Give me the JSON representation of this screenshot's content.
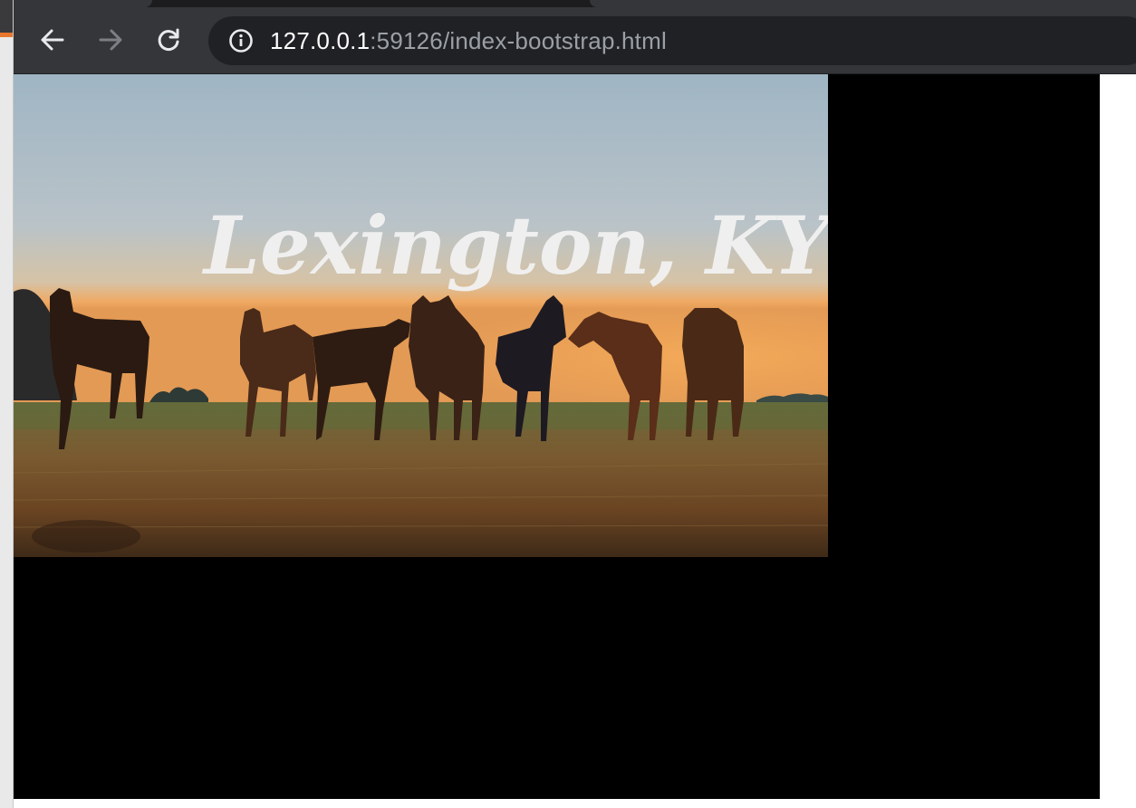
{
  "browser": {
    "url_host": "127.0.0.1",
    "url_path": ":59126/index-bootstrap.html"
  },
  "page": {
    "hero_logo_text": "Lexington, KY",
    "hero_alt": "Horses in a field at sunrise"
  },
  "colors": {
    "toolbar": "#35363a",
    "omnibox": "#202124",
    "page_background": "#000000",
    "accent": "#e8772e"
  },
  "icons": {
    "back": "arrow-left-icon",
    "forward": "arrow-right-icon",
    "reload": "reload-icon",
    "site_info": "info-icon"
  }
}
